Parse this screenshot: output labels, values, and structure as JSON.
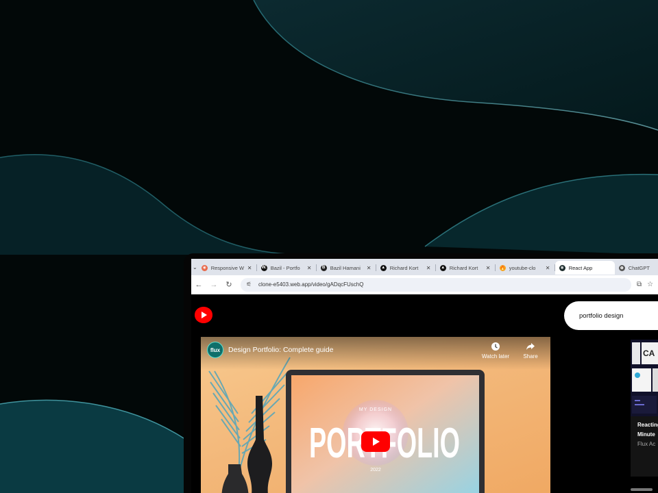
{
  "browser": {
    "tabs": [
      {
        "title": "Responsive W",
        "favicon": "asterisk-icon",
        "color": "#e8694a",
        "glyph": "✳",
        "active": false
      },
      {
        "title": "Bazil - Portfo",
        "favicon": "w-logo-icon",
        "color": "#111111",
        "glyph": "W.",
        "active": false
      },
      {
        "title": "Bazil Hamani",
        "favicon": "b-logo-icon",
        "color": "#222222",
        "glyph": "B",
        "active": false
      },
      {
        "title": "Richard Kort",
        "favicon": "triangle-logo-icon",
        "color": "#111111",
        "glyph": "▲",
        "active": false
      },
      {
        "title": "Richard Kort",
        "favicon": "triangle-logo-icon",
        "color": "#111111",
        "glyph": "▲",
        "active": false
      },
      {
        "title": "youtube-clo",
        "favicon": "firebase-icon",
        "color": "#f5a623",
        "glyph": "🔥",
        "active": false
      },
      {
        "title": "React App",
        "favicon": "react-icon",
        "color": "#1b2b2b",
        "glyph": "⚛",
        "active": true
      },
      {
        "title": "ChatGPT",
        "favicon": "chatgpt-icon",
        "color": "#555555",
        "glyph": "⊛",
        "active": false
      }
    ],
    "url": "clone-e5403.web.app/video/gADqcFUschQ"
  },
  "header": {
    "search_value": "portfolio design"
  },
  "player": {
    "title": "Design Portfolio: Complete guide",
    "channel_initials": "flux",
    "watch_later_label": "Watch later",
    "share_label": "Share",
    "art_small_top": "MY DESIGN",
    "art_big": "PORTFOLIO",
    "art_year": "2022"
  },
  "sidebar": {
    "card_title_line1": "Reacting",
    "card_title_line2": "Minute",
    "card_channel": "Flux Ac"
  },
  "colors": {
    "youtube_red": "#ff0000",
    "tabstrip": "#dfe3eb"
  }
}
